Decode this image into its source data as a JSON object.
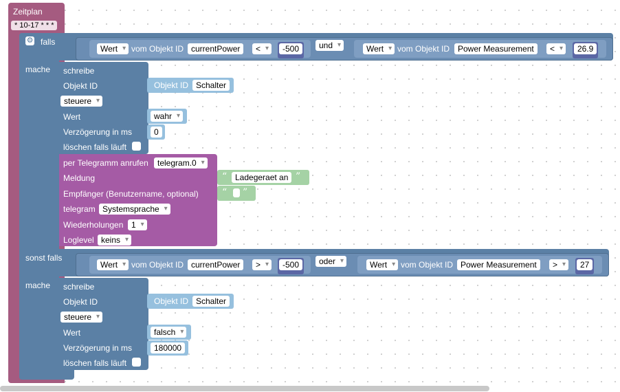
{
  "schedule": {
    "label": "Zeitplan",
    "cron": "* 10-17 * * *"
  },
  "if_block": {
    "if_label": "falls",
    "do_label": "mache",
    "else_if_label": "sonst falls",
    "do2_label": "mache"
  },
  "cond1": {
    "left": {
      "dropdown": "Wert",
      "text": "vom Objekt ID",
      "id": "currentPower",
      "op": "<",
      "value": "-500"
    },
    "logic": "und",
    "right": {
      "dropdown": "Wert",
      "text": "vom Objekt ID",
      "id": "Power Measurement",
      "op": "<",
      "value": "26.9"
    }
  },
  "cond2": {
    "left": {
      "dropdown": "Wert",
      "text": "vom Objekt ID",
      "id": "currentPower",
      "op": ">",
      "value": "-500"
    },
    "logic": "oder",
    "right": {
      "dropdown": "Wert",
      "text": "vom Objekt ID",
      "id": "Power Measurement",
      "op": ">",
      "value": "27"
    }
  },
  "write1": {
    "title": "schreibe",
    "object_label": "Objekt ID",
    "object_prefix": "Objekt ID",
    "object_value": "Schalter",
    "mode": "steuere",
    "value_label": "Wert",
    "value": "wahr",
    "delay_label": "Verzögerung in ms",
    "delay": "0",
    "clear_label": "löschen falls läuft"
  },
  "telegram": {
    "title": "per Telegramm anrufen",
    "instance": "telegram.0",
    "message_label": "Meldung",
    "message": "Ladegeraet an",
    "recipient_label": "Empfänger (Benutzername, optional)",
    "telegram_label": "telegram",
    "language": "Systemsprache",
    "repeat_label": "Wiederholungen",
    "repeat": "1",
    "loglevel_label": "Loglevel",
    "loglevel": "keins"
  },
  "write2": {
    "title": "schreibe",
    "object_label": "Objekt ID",
    "object_prefix": "Objekt ID",
    "object_value": "Schalter",
    "mode": "steuere",
    "value_label": "Wert",
    "value": "falsch",
    "delay_label": "Verzögerung in ms",
    "delay": "180000",
    "clear_label": "löschen falls läuft"
  },
  "quotes": {
    "open": "“",
    "close": "”"
  },
  "colors": {
    "schedule": "#a55b80",
    "logic": "#5b80a5",
    "action": "#5b80a5",
    "telegram": "#a55ba5",
    "text": "#a5d2a5",
    "number": "#5b67a5"
  }
}
